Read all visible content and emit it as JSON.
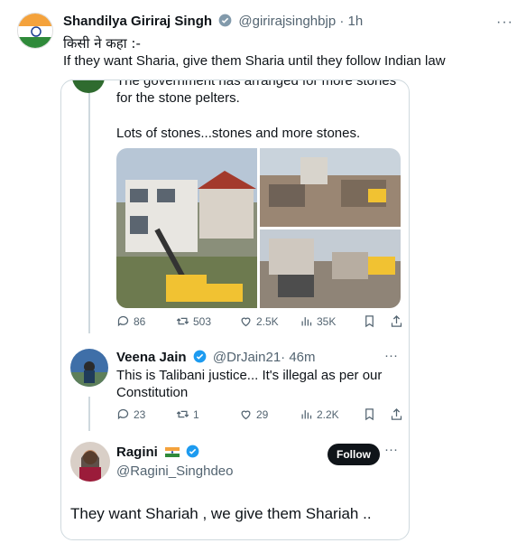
{
  "colors": {
    "accent": "#1d9bf0",
    "text": "#0f1419",
    "muted": "#536471",
    "border": "#cfd9de"
  },
  "main_tweet": {
    "name": "Shandilya Giriraj Singh",
    "handle": "@girirajsinghbjp",
    "time": "· 1h",
    "line1": "किसी ने कहा :-",
    "line2": "If they want Sharia, give them Sharia until they follow Indian law",
    "more": "···"
  },
  "quoted": {
    "cut_line": "The government has arranged for more stones",
    "line1": "for the stone pelters.",
    "line2": "Lots of stones...stones and more stones.",
    "actions": {
      "replies": "86",
      "retweets": "503",
      "likes": "2.5K",
      "views": "35K"
    }
  },
  "reply": {
    "name": "Veena Jain",
    "handle": "@DrJain21",
    "time": "· 46m",
    "text": "This is Talibani justice... It's illegal as per our Constitution",
    "more": "···",
    "actions": {
      "replies": "23",
      "retweets": "1",
      "likes": "29",
      "views": "2.2K"
    }
  },
  "ragini": {
    "name": "Ragini",
    "handle": "@Ragini_Singhdeo",
    "follow_label": "Follow",
    "more": "···",
    "text": "They want Shariah , we give them Shariah .."
  }
}
